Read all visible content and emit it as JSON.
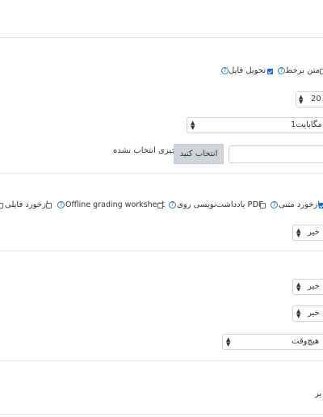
{
  "submission_types": {
    "online_text_label": "متن برخط",
    "file_submissions_label": "تحویل فایل"
  },
  "word_limit": {
    "value": "20"
  },
  "max_size": {
    "value": "1مگابایت"
  },
  "file_types": {
    "choose_button": "انتخاب کنید",
    "none_selected": "چیزی انتخاب نشده"
  },
  "feedback_types": {
    "comments_label": "بازخورد متنی",
    "annotate_pdf_label": "یادداشت‌نویسی روی PDF",
    "offline_grading_label": "Offline grading worksheet",
    "files_label": "بازخورد فایلی"
  },
  "inline_comments": {
    "value": "خیر"
  },
  "submit_button_required": {
    "value": "خیر"
  },
  "submission_statement": {
    "value": "خیر"
  },
  "attempts_reopened": {
    "value": "هیچ‌وقت"
  },
  "cut_text": "یر",
  "colors": {
    "checkbox_checked": "#1769c9",
    "help": "#2b7fc0",
    "button_bg": "#ced4da"
  }
}
